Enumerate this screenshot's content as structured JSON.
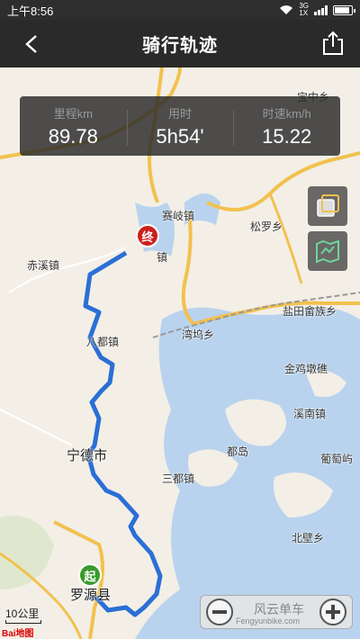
{
  "status_bar": {
    "time": "上午8:56",
    "network_top": "3G",
    "network_bottom": "1X"
  },
  "nav": {
    "title": "骑行轨迹",
    "back_icon": "back-arrow-icon",
    "share_icon": "share-icon"
  },
  "stats": [
    {
      "label": "里程km",
      "value": "89.78"
    },
    {
      "label": "用时",
      "value": "5h54'"
    },
    {
      "label": "时速km/h",
      "value": "15.22"
    }
  ],
  "map": {
    "places": {
      "zhongxiang": "宝中乡",
      "saiqi": "赛岐镇",
      "songluo": "松罗乡",
      "chixi": "赤溪镇",
      "endtown": "镇",
      "yantian": "盐田畲族乡",
      "badu": "八都镇",
      "wanwu": "湾坞乡",
      "jinjidun": "金鸡墩礁",
      "xinan": "溪南镇",
      "ningde": "宁德市",
      "dudao": "都岛",
      "putaoyu": "葡萄屿",
      "sandu": "三都镇",
      "beibi": "北壁乡",
      "luoyuan": "罗源县"
    },
    "markers": {
      "end": "终",
      "start": "起"
    },
    "scale": "10公里",
    "logo": "Bai地图",
    "watermark": "风云单车",
    "watermark_url": "Fengyunbike.com"
  },
  "colors": {
    "route": "#2b6fd6",
    "road_yellow": "#f2c14e",
    "sea": "#b9d3ee",
    "land": "#f3efe6"
  }
}
